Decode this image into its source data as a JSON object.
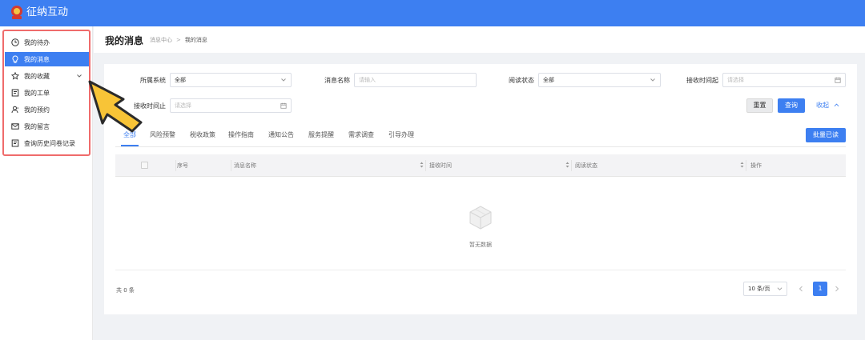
{
  "app": {
    "title": "征纳互动"
  },
  "sidebar": {
    "items": [
      {
        "label": "我的待办",
        "icon": "clock-icon",
        "active": false
      },
      {
        "label": "我的消息",
        "icon": "lightbulb-icon",
        "active": true
      },
      {
        "label": "我的收藏",
        "icon": "star-icon",
        "active": false,
        "expandable": true
      },
      {
        "label": "我的工单",
        "icon": "document-icon",
        "active": false
      },
      {
        "label": "我的预约",
        "icon": "user-icon",
        "active": false
      },
      {
        "label": "我的留言",
        "icon": "mail-icon",
        "active": false
      },
      {
        "label": "查询历史问卷记录",
        "icon": "document-icon",
        "active": false
      }
    ]
  },
  "header": {
    "title": "我的消息",
    "breadcrumb": [
      "消息中心",
      "我的消息"
    ]
  },
  "filters": {
    "system": {
      "label": "所属系统",
      "value": "全部"
    },
    "message_name": {
      "label": "消息名称",
      "placeholder": "请输入"
    },
    "read_status": {
      "label": "阅读状态",
      "value": "全部"
    },
    "receive_start": {
      "label": "接收时间起",
      "placeholder": "请选择"
    },
    "receive_end": {
      "label": "接收时间止",
      "placeholder": "请选择"
    },
    "reset_label": "重置",
    "query_label": "查询",
    "collapse_label": "收起"
  },
  "tabs": [
    "全部",
    "风险预警",
    "税收政策",
    "操作指南",
    "通知公告",
    "服务提醒",
    "需求调查",
    "引导办理"
  ],
  "batch_read_label": "批量已读",
  "table": {
    "columns": [
      "序号",
      "消息名称",
      "接收时间",
      "阅读状态",
      "操作"
    ],
    "empty_text": "暂无数据"
  },
  "pagination": {
    "total_text": "共 0 条",
    "page_size": "10 条/页",
    "current_page": "1"
  },
  "colors": {
    "primary": "#3d7ff1",
    "highlight_border": "#ef6b6b",
    "pointer": "#f8c437"
  }
}
